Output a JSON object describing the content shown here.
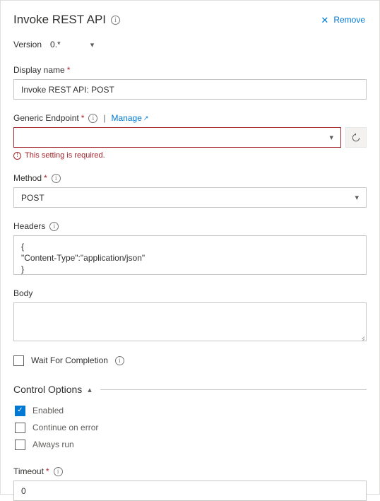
{
  "header": {
    "title": "Invoke REST API",
    "info_icon": "info-icon",
    "remove_label": "Remove",
    "close_icon": "close-icon"
  },
  "version": {
    "label": "Version",
    "value": "0.*",
    "chevron_icon": "chevron-down-icon"
  },
  "display_name": {
    "label": "Display name",
    "required_mark": "*",
    "value": "Invoke REST API: POST"
  },
  "generic_endpoint": {
    "label": "Generic Endpoint",
    "required_mark": "*",
    "info_icon": "info-icon",
    "separator": "|",
    "manage_label": "Manage",
    "external_icon": "external-link-icon",
    "value": "",
    "chevron_icon": "chevron-down-icon",
    "refresh_icon": "refresh-icon",
    "error_text": "This setting is required.",
    "error_icon": "error-icon",
    "error_color": "#a4262c"
  },
  "method": {
    "label": "Method",
    "required_mark": "*",
    "info_icon": "info-icon",
    "value": "POST",
    "chevron_icon": "chevron-down-icon"
  },
  "headers": {
    "label": "Headers",
    "info_icon": "info-icon",
    "value": "{\n\"Content-Type\":\"application/json\"\n}"
  },
  "body": {
    "label": "Body",
    "value": ""
  },
  "wait_for_completion": {
    "label": "Wait For Completion",
    "checked": false,
    "info_icon": "info-icon"
  },
  "control_options": {
    "title": "Control Options",
    "chevron_icon": "chevron-up-icon",
    "items": [
      {
        "label": "Enabled",
        "checked": true
      },
      {
        "label": "Continue on error",
        "checked": false
      },
      {
        "label": "Always run",
        "checked": false
      }
    ]
  },
  "timeout": {
    "label": "Timeout",
    "required_mark": "*",
    "info_icon": "info-icon",
    "value": "0"
  },
  "colors": {
    "accent": "#0078d4",
    "error": "#a4262c",
    "border": "#c8c6c4",
    "text": "#323130"
  }
}
